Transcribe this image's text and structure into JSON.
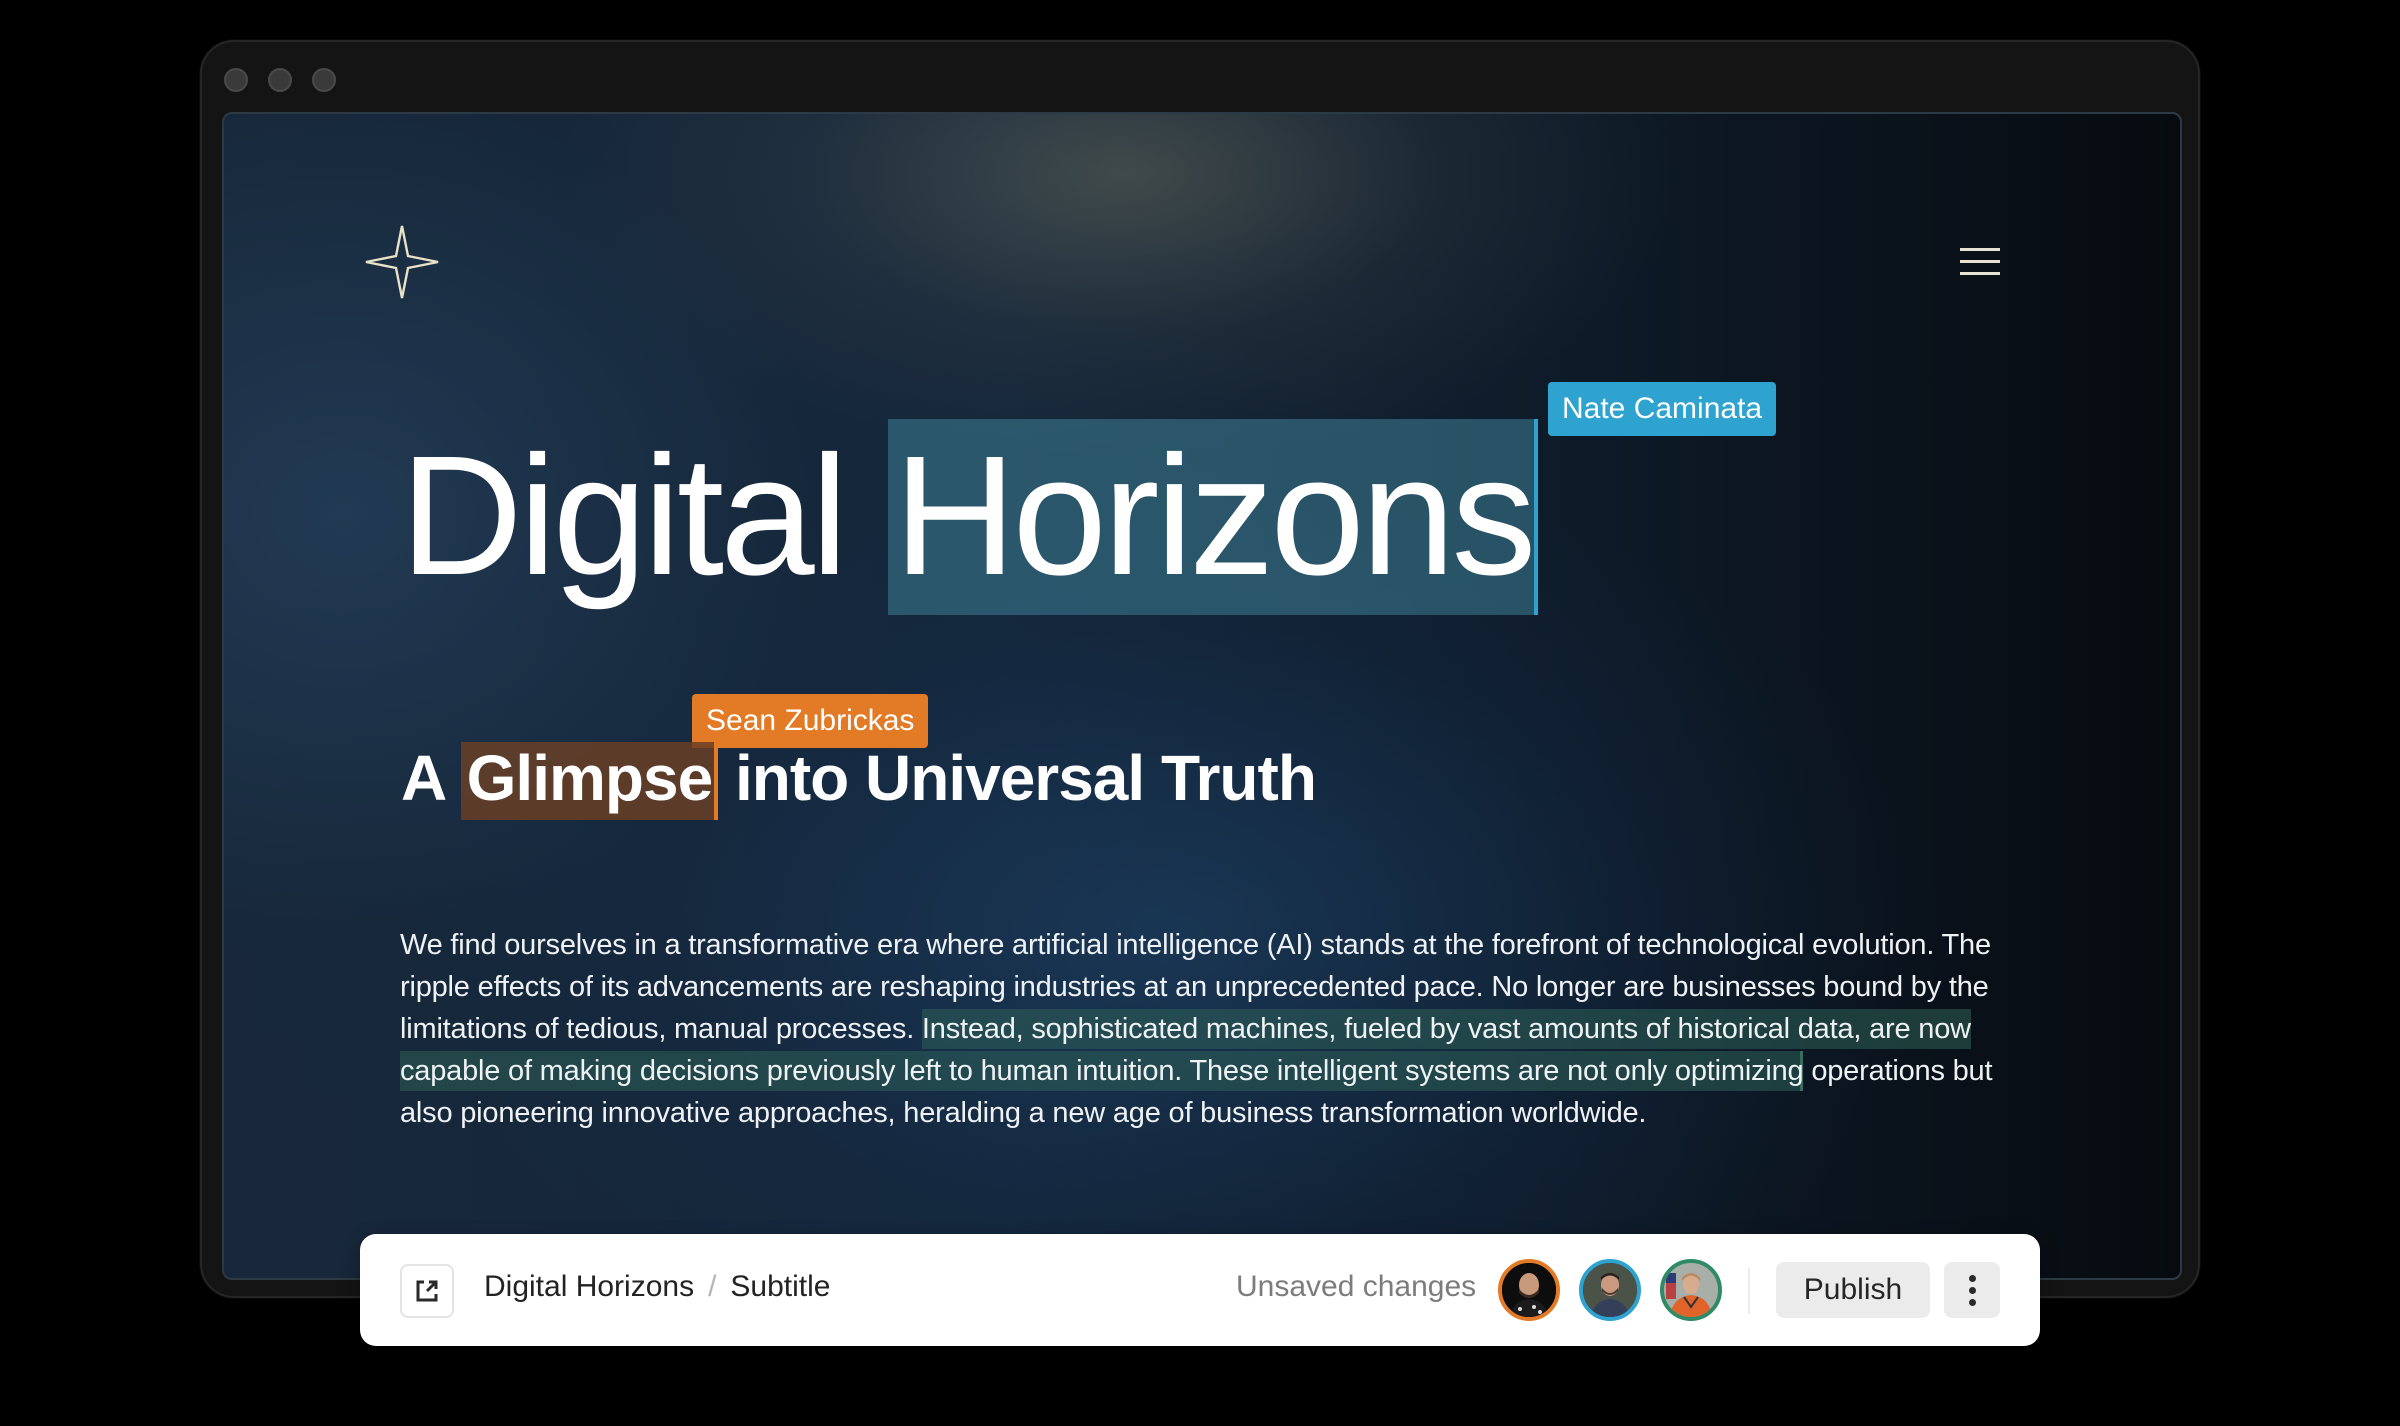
{
  "window": {
    "traffic_lights": [
      "close",
      "minimize",
      "maximize"
    ]
  },
  "page": {
    "logo_icon": "four-point-star-icon",
    "menu_icon": "hamburger-menu-icon",
    "title": {
      "plain": "Digital ",
      "highlighted": "Horizons"
    },
    "subtitle": {
      "prefix": "A ",
      "highlighted": "Glimpse",
      "suffix": " into Universal Truth"
    },
    "body": {
      "before": "We find ourselves in a transformative era where artificial intelligence (AI) stands at the forefront of technological evolution. The ripple effects of its advancements are reshaping industries at an unprecedented pace. No longer are businesses bound by the limitations of tedious, manual processes. ",
      "highlighted": "Instead, sophisticated machines, fueled by vast amounts of historical data, are now capable of making decisions previously left to human intuition. These intelligent systems are not only optimizing",
      "after": " operations but also pioneering innovative approaches, heralding a new age of business transformation worldwide."
    }
  },
  "collaborators": [
    {
      "name": "Nate Caminata",
      "color": "#2ea3cf",
      "selection": "title"
    },
    {
      "name": "Sean Zubrickas",
      "color": "#e37a25",
      "selection": "subtitle"
    },
    {
      "name": "",
      "color": "#2f8a66",
      "selection": "body"
    }
  ],
  "toolbar": {
    "open_icon": "external-link-icon",
    "breadcrumb": [
      "Digital Horizons",
      "Subtitle"
    ],
    "breadcrumb_separator": "/",
    "status": "Unsaved changes",
    "avatars": [
      {
        "ring_color": "#e37a25"
      },
      {
        "ring_color": "#2ea3cf"
      },
      {
        "ring_color": "#2f8a66"
      }
    ],
    "publish_label": "Publish",
    "more_icon": "more-vertical-icon"
  }
}
